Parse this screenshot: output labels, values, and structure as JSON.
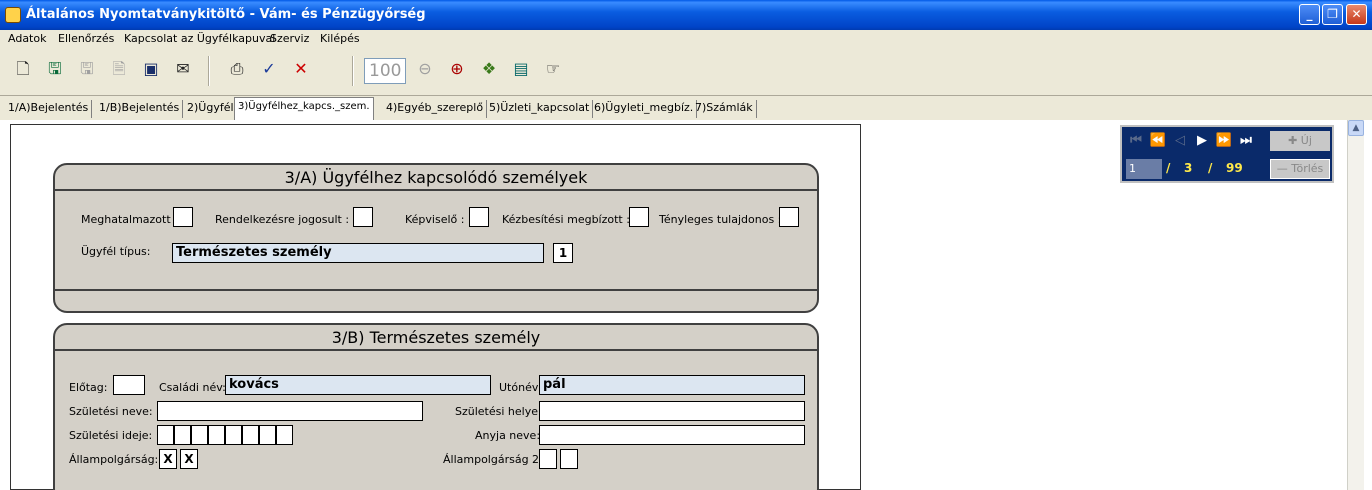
{
  "window": {
    "title": "Általános Nyomtatványkitöltő - Vám- és Pénzügyőrség",
    "buttons": [
      "_",
      "❐",
      "✕"
    ]
  },
  "menu": [
    "Adatok",
    "Ellenőrzés",
    "Kapcsolat az Ügyfélkapuval",
    "Szerviz",
    "Kilépés"
  ],
  "toolbar": {
    "zoom": "100",
    "icons": [
      "new-doc-icon",
      "save-icon",
      "save-as-icon",
      "import-icon",
      "info-icon",
      "mail-icon",
      "print-icon",
      "check-icon",
      "delete-icon",
      "zoom-out-icon",
      "zoom-in-icon",
      "tree-icon",
      "list-icon",
      "hand-icon"
    ]
  },
  "tabs": [
    "1/A)Bejelentés",
    "1/B)Bejelentés",
    "2)Ügyfél",
    "3)Ügyfélhez_kapcs._szem.",
    "4)Egyéb_szereplő",
    "5)Üzleti_kapcsolat",
    "6)Ügyleti_megbíz.",
    "7)Számlák"
  ],
  "active_tab": "3)Ügyfélhez_kapcs._szem.",
  "section_a": {
    "title": "3/A) Ügyfélhez kapcsolódó személyek",
    "checks": {
      "meghatalmazott": "Meghatalmazott :",
      "rendelkezesre": "Rendelkezésre jogosult :",
      "kepviselo": "Képviselő :",
      "kezbesitesi": "Kézbesítési megbízott :",
      "tenyleges": "Tényleges tulajdonos :"
    },
    "type_label": "Ügyfél típus:",
    "type_value": "Természetes személy",
    "type_code": "1"
  },
  "section_b": {
    "title": "3/B) Természetes személy",
    "elotag": "Előtag:",
    "csaladi_label": "Családi név:",
    "csaladi_value": "kovács",
    "utonev_label": "Utónév:",
    "utonev_value": "pál",
    "szuletesi_neve": "Születési neve:",
    "szuletesi_helye": "Születési helye:",
    "szuletesi_ideje": "Születési ideje:",
    "anyja_neve": "Anyja neve:",
    "allampolgarsag": "Állampolgárság:",
    "allampolgarsag_value": [
      "X",
      "X"
    ],
    "allampolgarsag2": "Állampolgárság 2:"
  },
  "navigator": {
    "current": "1",
    "total": "3",
    "max": "99",
    "delete": "Törlés",
    "new": "Új"
  }
}
